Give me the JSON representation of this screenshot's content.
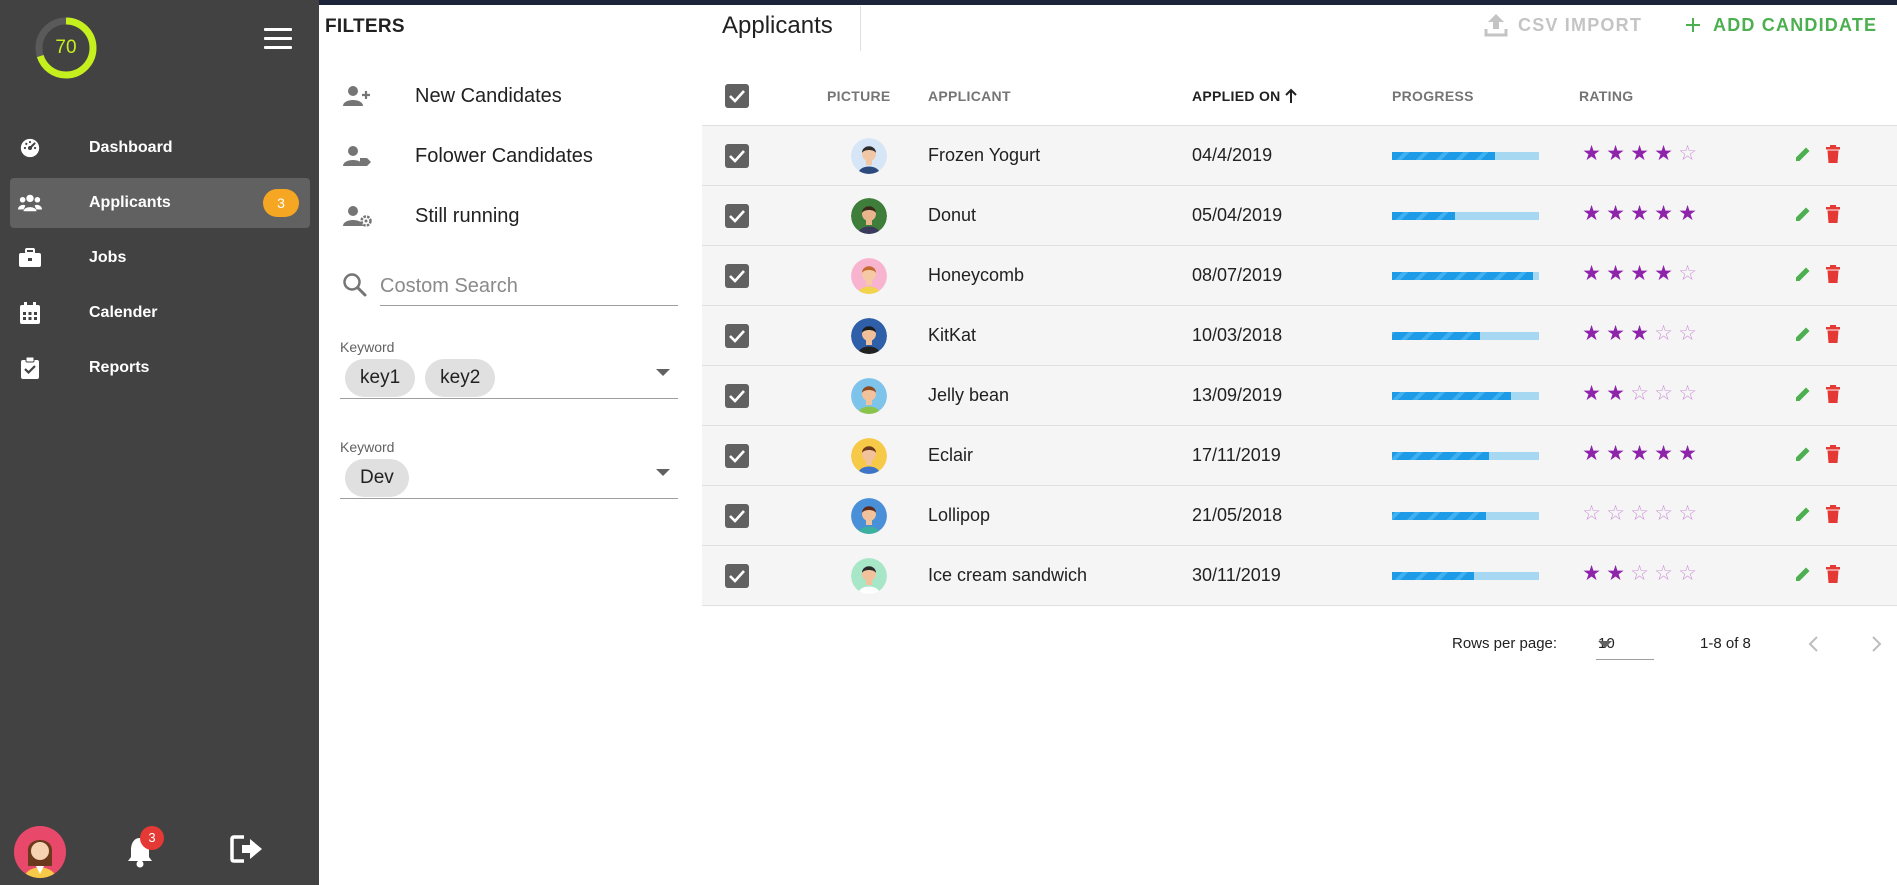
{
  "sidebar": {
    "score": "70",
    "score_fraction": 0.7,
    "items": [
      {
        "label": "Dashboard",
        "icon": "dashboard-gauge-icon"
      },
      {
        "label": "Applicants",
        "icon": "users-icon",
        "badge": "3",
        "active": true
      },
      {
        "label": "Jobs",
        "icon": "briefcase-icon"
      },
      {
        "label": "Calender",
        "icon": "calendar-icon"
      },
      {
        "label": "Reports",
        "icon": "clipboard-icon"
      }
    ],
    "notifications_count": "3"
  },
  "filters": {
    "title": "FILTERS",
    "items": [
      {
        "label": "New Candidates",
        "icon": "person-add-icon"
      },
      {
        "label": "Folower Candidates",
        "icon": "person-tag-icon"
      },
      {
        "label": "Still running",
        "icon": "person-gear-icon"
      }
    ],
    "search_placeholder": "Costom Search",
    "keyword_fields": [
      {
        "label": "Keyword",
        "chips": [
          "key1",
          "key2"
        ]
      },
      {
        "label": "Keyword",
        "chips": [
          "Dev"
        ]
      }
    ]
  },
  "main": {
    "title": "Applicants",
    "csv_import": "CSV IMPORT",
    "add_candidate": "ADD CANDIDATE",
    "columns": {
      "picture": "PICTURE",
      "applicant": "APPLICANT",
      "applied_on": "APPLIED ON",
      "progress": "PROGRESS",
      "rating": "RATING"
    },
    "rows": [
      {
        "name": "Frozen Yogurt",
        "date": "04/4/2019",
        "progress": 0.7,
        "rating": 4,
        "avatar": {
          "bg": "#d6e6f7",
          "skin": "#f2c7a5",
          "hair": "#2d2d2d",
          "shirt": "#2c4a7c"
        }
      },
      {
        "name": "Donut",
        "date": "05/04/2019",
        "progress": 0.43,
        "rating": 5,
        "avatar": {
          "bg": "#3f7d3a",
          "skin": "#e8b58c",
          "hair": "#3a2a1c",
          "shirt": "#3a3a5c"
        }
      },
      {
        "name": "Honeycomb",
        "date": "08/07/2019",
        "progress": 0.96,
        "rating": 4,
        "avatar": {
          "bg": "#f8b4cf",
          "skin": "#f4c9a3",
          "hair": "#c46a2e",
          "shirt": "#f2d34c"
        }
      },
      {
        "name": "KitKat",
        "date": "10/03/2018",
        "progress": 0.6,
        "rating": 3,
        "avatar": {
          "bg": "#2f5fa8",
          "skin": "#f0c09a",
          "hair": "#1d1d1d",
          "shirt": "#222222"
        }
      },
      {
        "name": "Jelly bean",
        "date": "13/09/2019",
        "progress": 0.81,
        "rating": 2,
        "avatar": {
          "bg": "#7dc3ea",
          "skin": "#f2c29c",
          "hair": "#8a4b22",
          "shirt": "#8bc34a"
        }
      },
      {
        "name": "Eclair",
        "date": "17/11/2019",
        "progress": 0.66,
        "rating": 5,
        "avatar": {
          "bg": "#f7c948",
          "skin": "#f2c29c",
          "hair": "#6b3a1c",
          "shirt": "#3b74c8"
        }
      },
      {
        "name": "Lollipop",
        "date": "21/05/2018",
        "progress": 0.64,
        "rating": 0,
        "avatar": {
          "bg": "#4a90d9",
          "skin": "#f2c29c",
          "hair": "#5b2a1a",
          "shirt": "#3bb0a0"
        }
      },
      {
        "name": "Ice cream sandwich",
        "date": "30/11/2019",
        "progress": 0.56,
        "rating": 2,
        "avatar": {
          "bg": "#a8e6c8",
          "skin": "#f2c29c",
          "hair": "#2a2a2a",
          "shirt": "#ffffff"
        }
      }
    ],
    "pagination": {
      "rows_per_page_label": "Rows per page:",
      "rows_per_page": "10",
      "range": "1-8 of 8"
    }
  },
  "colors": {
    "sidebar_bg": "#424242",
    "score_ring": "#c6ef1e",
    "badge": "#f5a623",
    "accent_green": "#4caf50",
    "star_purple": "#8e24aa",
    "delete_red": "#e53935",
    "progress_blue": "#1e9be6"
  }
}
